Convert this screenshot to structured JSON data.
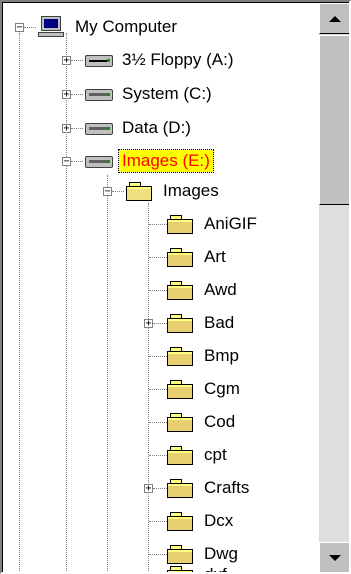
{
  "tree": {
    "root": {
      "label": "My Computer",
      "icon": "computer-icon",
      "expanded": true
    },
    "drives": [
      {
        "label": "3½ Floppy (A:)",
        "icon": "floppy-drive-icon",
        "expanded": false
      },
      {
        "label": "System (C:)",
        "icon": "hard-drive-icon",
        "expanded": false
      },
      {
        "label": "Data (D:)",
        "icon": "hard-drive-icon",
        "expanded": false
      },
      {
        "label": "Images (E:)",
        "icon": "hard-drive-icon",
        "expanded": true,
        "selected": true
      }
    ],
    "images_folder": {
      "label": "Images",
      "icon": "folder-open-icon",
      "expanded": true
    },
    "subfolders": [
      {
        "label": "AniGIF",
        "has_children": false
      },
      {
        "label": "Art",
        "has_children": false
      },
      {
        "label": "Awd",
        "has_children": false
      },
      {
        "label": "Bad",
        "has_children": true
      },
      {
        "label": "Bmp",
        "has_children": false
      },
      {
        "label": "Cgm",
        "has_children": false
      },
      {
        "label": "Cod",
        "has_children": false
      },
      {
        "label": "cpt",
        "has_children": false
      },
      {
        "label": "Crafts",
        "has_children": true
      },
      {
        "label": "Dcx",
        "has_children": false
      },
      {
        "label": "Dwg",
        "has_children": false
      },
      {
        "label": "dxf",
        "has_children": false
      }
    ]
  },
  "colors": {
    "selected_bg": "#ffff00",
    "selected_text": "#ff0000",
    "window_bg": "#ffffff",
    "chrome": "#c0c0c0"
  }
}
